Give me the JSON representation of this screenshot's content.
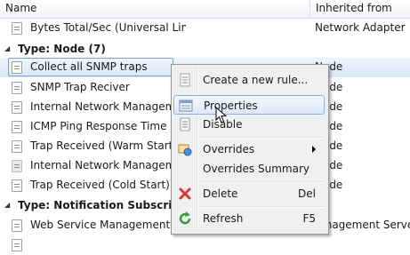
{
  "columns": {
    "name": "Name",
    "inherited": "Inherited from"
  },
  "rows": [
    {
      "name": "Bytes Total/Sec (Universal Linux)",
      "inherited": "Network Adapter"
    }
  ],
  "groups": [
    {
      "label": "Type: Node (7)",
      "rows": [
        {
          "name": "Collect all SNMP traps",
          "inherited": "Node"
        },
        {
          "name": "SNMP Trap Reciver",
          "inherited": "Node"
        },
        {
          "name": "Internal Network Management",
          "inherited": "Node"
        },
        {
          "name": "ICMP Ping Response Time",
          "inherited": "Node"
        },
        {
          "name": "Trap Received (Warm Start)",
          "inherited": "Node"
        },
        {
          "name": "Internal Network Management",
          "inherited": "Node"
        },
        {
          "name": "Trap Received (Cold Start)",
          "inherited": "Node"
        }
      ]
    },
    {
      "label": "Type: Notification Subscription S",
      "rows": [
        {
          "name": "Web Service Management: Ve",
          "inherited": "Management Server"
        }
      ]
    }
  ],
  "context_menu": {
    "items": [
      {
        "label": "Create a new rule...",
        "icon": "document-icon"
      },
      {
        "label": "Properties",
        "icon": "properties-icon"
      },
      {
        "label": "Disable",
        "icon": "document-icon"
      },
      {
        "label": "Overrides",
        "icon": "overrides-icon"
      },
      {
        "label": "Overrides Summary"
      },
      {
        "label": "Delete",
        "shortcut": "Del",
        "icon": "delete-icon"
      },
      {
        "label": "Refresh",
        "shortcut": "F5",
        "icon": "refresh-icon"
      }
    ]
  },
  "colors": {
    "selection_border": "#7da2ce",
    "menu_bg": "#f0f0f0",
    "delete_red": "#d23b3b",
    "refresh_green": "#3a9b3a"
  }
}
